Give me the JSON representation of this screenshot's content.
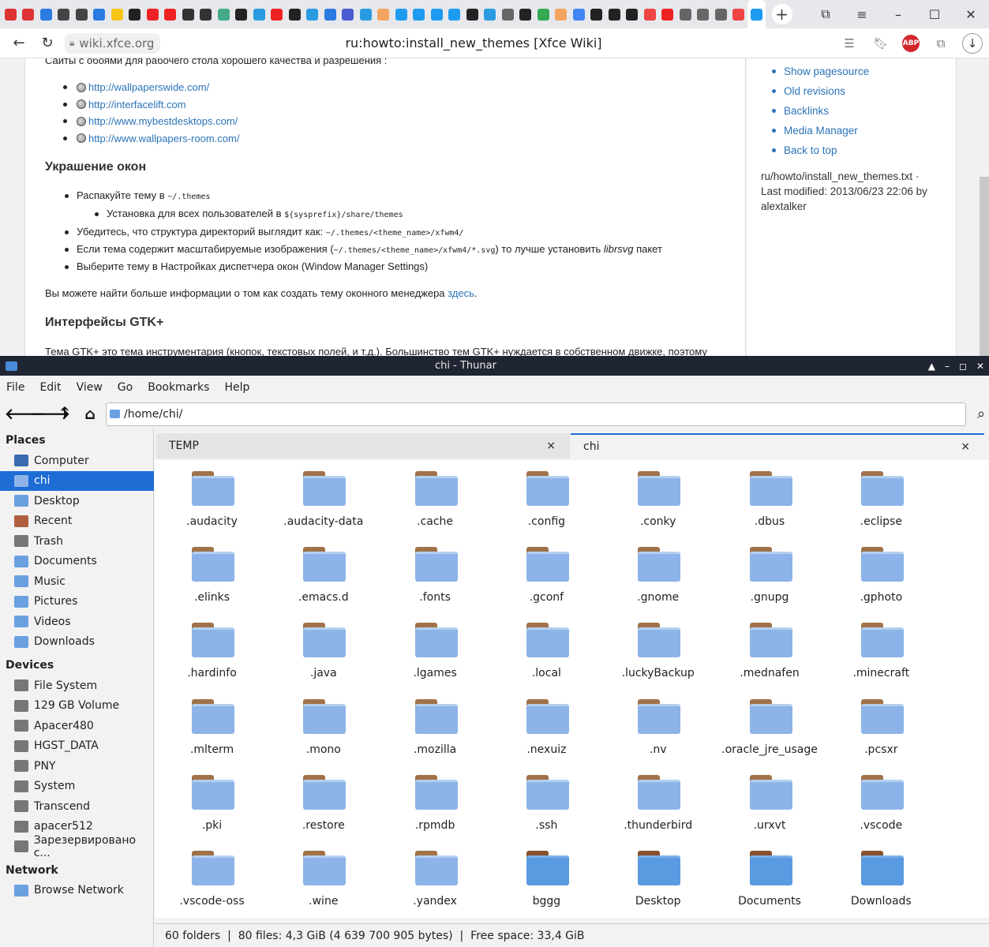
{
  "browser": {
    "domain": "wiki.xfce.org",
    "page_title": "ru:howto:install_new_themes [Xfce Wiki]",
    "abp_label": "ABP",
    "favicon_colors": [
      "#d33",
      "#d33",
      "#2a7ae2",
      "#444",
      "#444",
      "#2a7ae2",
      "#f5c518",
      "#222",
      "#e22",
      "#e22",
      "#333",
      "#333",
      "#4a8",
      "#222",
      "#2a9be0",
      "#e22",
      "#222",
      "#2a9be0",
      "#2a7ae2",
      "#4a5ad0",
      "#2a9be0",
      "#f4a460",
      "#1d9bf0",
      "#1d9bf0",
      "#1d9bf0",
      "#1d9bf0",
      "#222",
      "#2a9be0",
      "#666",
      "#222",
      "#34a853",
      "#f4a460",
      "#4285f4",
      "#222",
      "#222",
      "#222",
      "#e44",
      "#e22",
      "#666",
      "#666",
      "#666",
      "#e44",
      "#1d9bf0"
    ]
  },
  "article": {
    "intro": "Сайты с обоями для рабочего стола хорошего качества и разрешения :",
    "links": [
      "http://wallpaperswide.com/",
      "http://interfacelift.com",
      "http://www.mybestdesktops.com/",
      "http://www.wallpapers-room.com/"
    ],
    "h_windows": "Украшение окон",
    "li1_a": "Распакуйте тему в ",
    "li1_code": "~/.themes",
    "li1sub_a": "Установка для всех пользователей в ",
    "li1sub_code": "${sysprefix}/share/themes",
    "li2_a": "Убедитесь, что структура директорий выглядит как: ",
    "li2_code": "~/.themes/<theme_name>/xfwm4/",
    "li3_a": "Если тема содержит масштабируемые изображения (",
    "li3_code": "~/.themes/<theme_name>/xfwm4/*.svg",
    "li3_b": ") то лучше установить ",
    "li3_em": "librsvg",
    "li3_c": " пакет",
    "li4": "Выберите тему в Настройках диспетчера окон (Window Manager Settings)",
    "more_a": "Вы можете найти больше информации о том как создать тему оконного менеджера ",
    "more_link": "здесь",
    "more_b": ".",
    "h_gtk": "Интерфейсы GTK+",
    "gtk_text": "Тема GTK+ это тема инструментария (кнопок, текстовых полей, и т.д.). Большинство тем GTK+ нуждается в собственном движке, поэтому"
  },
  "wiki_sidebar": {
    "links": [
      "Show pagesource",
      "Old revisions",
      "Backlinks",
      "Media Manager",
      "Back to top"
    ],
    "meta_line1": "ru/howto/install_new_themes.txt ·",
    "meta_line2": "Last modified: 2013/06/23 22:06 by",
    "meta_line3": "alextalker"
  },
  "thunar": {
    "title": "chi - Thunar",
    "menu": [
      "File",
      "Edit",
      "View",
      "Go",
      "Bookmarks",
      "Help"
    ],
    "path": "/home/chi/",
    "places_header": "Places",
    "places": [
      {
        "label": "Computer",
        "icon": "computer-icon",
        "color": "#3a6ab0"
      },
      {
        "label": "chi",
        "icon": "home-icon",
        "color": "#888"
      },
      {
        "label": "Desktop",
        "icon": "desktop-folder-icon",
        "color": "#6aa0e0"
      },
      {
        "label": "Recent",
        "icon": "recent-folder-icon",
        "color": "#b06040"
      },
      {
        "label": "Trash",
        "icon": "trash-icon",
        "color": "#777"
      },
      {
        "label": "Documents",
        "icon": "documents-folder-icon",
        "color": "#6aa0e0"
      },
      {
        "label": "Music",
        "icon": "music-folder-icon",
        "color": "#6aa0e0"
      },
      {
        "label": "Pictures",
        "icon": "pictures-folder-icon",
        "color": "#6aa0e0"
      },
      {
        "label": "Videos",
        "icon": "videos-folder-icon",
        "color": "#6aa0e0"
      },
      {
        "label": "Downloads",
        "icon": "downloads-folder-icon",
        "color": "#6aa0e0"
      }
    ],
    "devices_header": "Devices",
    "devices": [
      "File System",
      "129 GB Volume",
      "Apacer480",
      "HGST_DATA",
      "PNY",
      "System",
      "Transcend",
      "apacer512",
      "Зарезервировано с..."
    ],
    "network_header": "Network",
    "network": [
      "Browse Network"
    ],
    "tabs": [
      {
        "label": "TEMP",
        "close": "×"
      },
      {
        "label": "chi",
        "close": "×"
      }
    ],
    "files": [
      ".audacity",
      ".audacity-data",
      ".cache",
      ".config",
      ".conky",
      ".dbus",
      ".eclipse",
      ".elinks",
      ".emacs.d",
      ".fonts",
      ".gconf",
      ".gnome",
      ".gnupg",
      ".gphoto",
      ".hardinfo",
      ".java",
      ".lgames",
      ".local",
      ".luckyBackup",
      ".mednafen",
      ".minecraft",
      ".mlterm",
      ".mono",
      ".mozilla",
      ".nexuiz",
      ".nv",
      ".oracle_jre_usage",
      ".pcsxr",
      ".pki",
      ".restore",
      ".rpmdb",
      ".ssh",
      ".thunderbird",
      ".urxvt",
      ".vscode",
      ".vscode-oss",
      ".wine",
      ".yandex",
      "bggg",
      "Desktop",
      "Documents",
      "Downloads"
    ],
    "status": "60 folders  |  80 files: 4,3 GiB (4 639 700 905 bytes)  |  Free space: 33,4 GiB",
    "selection_color": "#1e6dd5"
  }
}
